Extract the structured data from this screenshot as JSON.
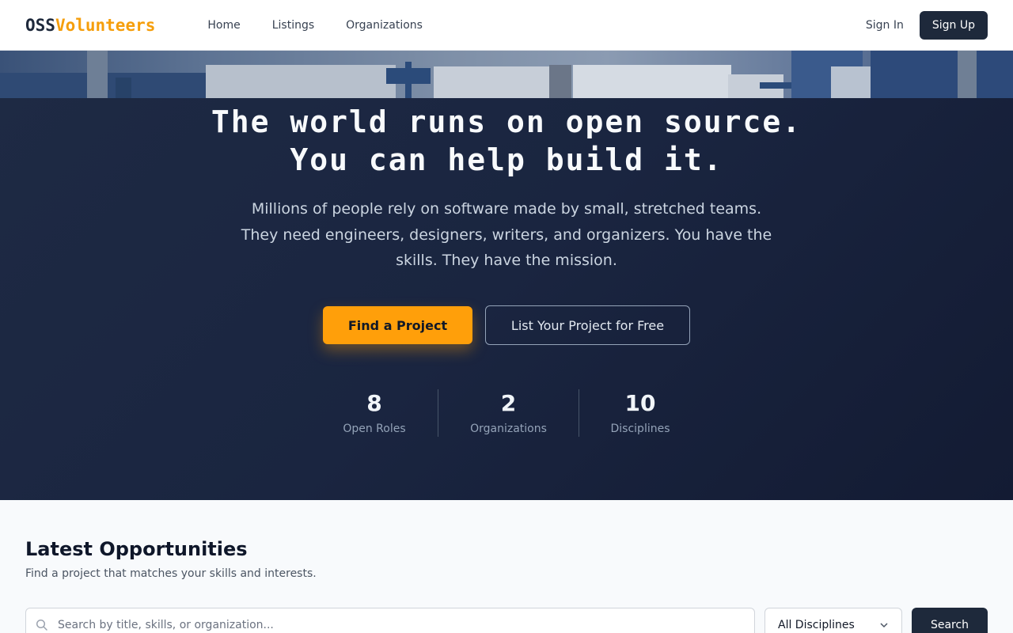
{
  "nav": {
    "logo_part1": "OSS",
    "logo_part2": "Volunteers",
    "links": [
      "Home",
      "Listings",
      "Organizations"
    ],
    "sign_in": "Sign In",
    "sign_up": "Sign Up"
  },
  "hero": {
    "title_line1": "The world runs on open source.",
    "title_line2": "You can help build it.",
    "subtitle": "Millions of people rely on software made by small, stretched teams. They need engineers, designers, writers, and organizers. You have the skills. They have the mission.",
    "cta_primary": "Find a Project",
    "cta_secondary": "List Your Project for Free",
    "stats": [
      {
        "value": "8",
        "label": "Open Roles"
      },
      {
        "value": "2",
        "label": "Organizations"
      },
      {
        "value": "10",
        "label": "Disciplines"
      }
    ]
  },
  "opportunities": {
    "title": "Latest Opportunities",
    "subtitle": "Find a project that matches your skills and interests.",
    "search_placeholder": "Search by title, skills, or organization...",
    "discipline_selected": "All Disciplines",
    "search_button": "Search"
  },
  "icons": {
    "search": "search-icon",
    "dropdown": "chevron-down-icon"
  },
  "colors": {
    "brand_dark": "#1e293b",
    "accent": "#ff9f0a",
    "logo_accent": "#f59e0b"
  }
}
